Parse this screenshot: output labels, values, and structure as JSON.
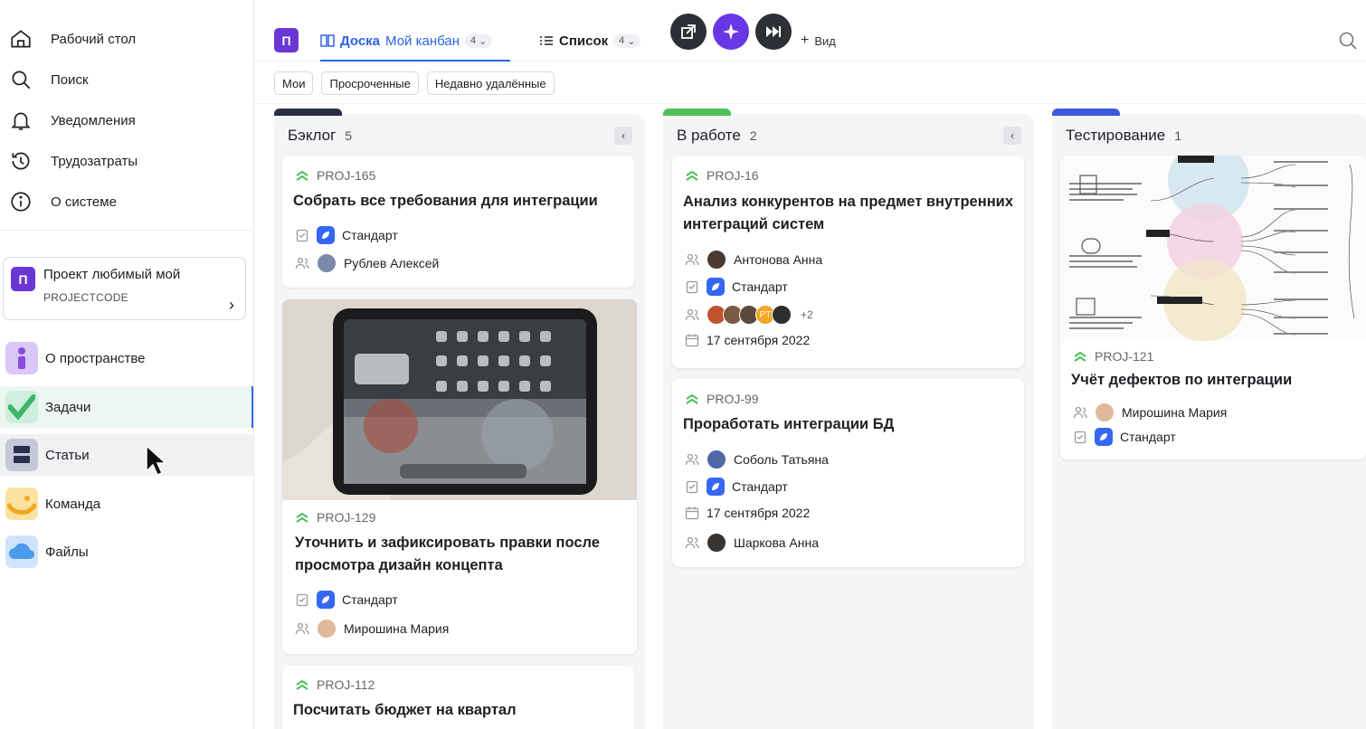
{
  "sidebar": {
    "nav": [
      {
        "label": "Рабочий стол",
        "icon": "home-icon"
      },
      {
        "label": "Поиск",
        "icon": "search-icon"
      },
      {
        "label": "Уведомления",
        "icon": "bell-icon"
      },
      {
        "label": "Трудозатраты",
        "icon": "history-icon"
      },
      {
        "label": "О системе",
        "icon": "info-icon"
      }
    ],
    "project": {
      "avatar": "П",
      "name": "Проект любимый мой",
      "code": "PROJECTCODE"
    },
    "spaces": [
      {
        "label": "О пространстве",
        "icon": "info-space-icon"
      },
      {
        "label": "Задачи",
        "icon": "check-icon",
        "active": true
      },
      {
        "label": "Статьи",
        "icon": "articles-icon"
      },
      {
        "label": "Команда",
        "icon": "team-icon"
      },
      {
        "label": "Файлы",
        "icon": "cloud-icon"
      }
    ]
  },
  "topbar": {
    "avatar": "П",
    "tabs": [
      {
        "prefix": "Доска",
        "label": "Мой канбан",
        "count": "4"
      },
      {
        "prefix": "Список",
        "label": "",
        "count": "4"
      }
    ],
    "add_view": "Вид"
  },
  "filters": [
    "Мои",
    "Просроченные",
    "Недавно удалённые"
  ],
  "colors": {
    "accent": "#2c63e0",
    "purple": "#6a37d6",
    "backlog_bar": "#2b2d48",
    "work_bar": "#4fbf5a",
    "test_bar": "#3c5adf"
  },
  "columns": [
    {
      "title": "Бэклог",
      "count": "5",
      "cards": [
        {
          "code": "PROJ-165",
          "title": "Собрать все требования для интеграции",
          "type": "Стандарт",
          "assignee": "Рублев Алексей"
        },
        {
          "code": "PROJ-129",
          "title": "Уточнить и зафиксировать правки после просмотра дизайн концепта",
          "type": "Стандарт",
          "assignee": "Мирошина Мария",
          "image": "tablet"
        },
        {
          "code": "PROJ-112",
          "title": "Посчитать бюджет на квартал"
        }
      ]
    },
    {
      "title": "В работе",
      "count": "2",
      "cards": [
        {
          "code": "PROJ-16",
          "title": "Анализ конкурентов на предмет внутренних интеграций систем",
          "assignee": "Антонова Анна",
          "type": "Стандарт",
          "watchers_more": "+2",
          "watcher_initials": "PT",
          "date": "17 сентября 2022"
        },
        {
          "code": "PROJ-99",
          "title": "Проработать интеграции БД",
          "assignee": "Соболь Татьяна",
          "type": "Стандарт",
          "date": "17 сентября 2022",
          "reviewer": "Шаркова Анна"
        }
      ]
    },
    {
      "title": "Тестирование",
      "count": "1",
      "cards": [
        {
          "code": "PROJ-121",
          "title": "Учёт дефектов по интеграции",
          "assignee": "Мирошина Мария",
          "type": "Стандарт",
          "image": "mindmap"
        }
      ]
    }
  ]
}
